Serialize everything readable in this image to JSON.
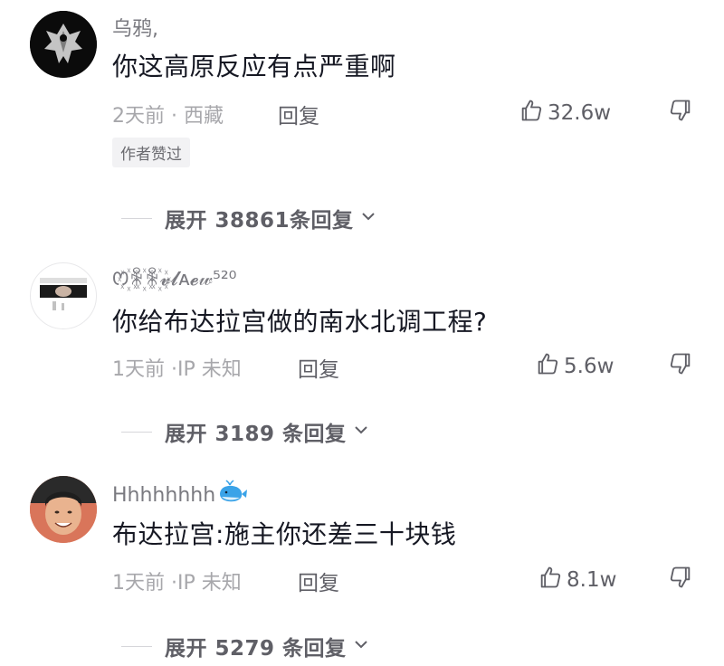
{
  "comments": [
    {
      "username": "乌鸦,",
      "content": "你这高原反应有点严重啊",
      "meta": "2天前 · 西藏",
      "reply_label": "回复",
      "likes": "32.6w",
      "tag": "作者赞过",
      "expand_label": "展开 38861条回复"
    },
    {
      "username": "ꯁ꙰ꆜ꙰ꆜ꙰𝓿𝓵ᴀ𝓮𝓌⁵²⁰",
      "content": "你给布达拉宫做的南水北调工程?",
      "meta": "1天前 ·IP 未知",
      "reply_label": "回复",
      "likes": "5.6w",
      "expand_label": "展开 3189 条回复"
    },
    {
      "username": "Hhhhhhhh",
      "content": "布达拉宫:施主你还差三十块钱",
      "meta": "1天前 ·IP 未知",
      "reply_label": "回复",
      "likes": "8.1w",
      "expand_label": "展开 5279 条回复"
    }
  ],
  "colors": {
    "text_primary": "#161823",
    "text_secondary": "#7a7a80",
    "text_meta": "#a7a7ab",
    "tag_bg": "#f2f2f4"
  },
  "icons": [
    "thumbs-up-icon",
    "thumbs-down-icon",
    "chevron-down-icon",
    "whale-emoji-icon"
  ]
}
